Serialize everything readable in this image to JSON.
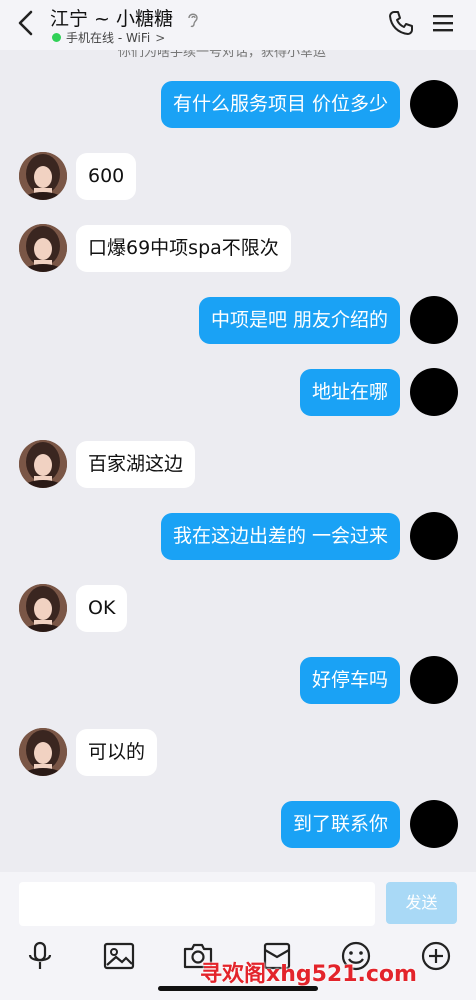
{
  "header": {
    "title": "江宁 ~ 小糖糖",
    "status": "手机在线 - WiFi",
    "status_chevron": ">"
  },
  "partial_top_text": "你们为啥手续一号对话，获得小幸运 ",
  "messages": [
    {
      "from": "me",
      "text": "有什么服务项目 价位多少"
    },
    {
      "from": "her",
      "text": "600"
    },
    {
      "from": "her",
      "text": "口爆69中项spa不限次"
    },
    {
      "from": "me",
      "text": "中项是吧 朋友介绍的"
    },
    {
      "from": "me",
      "text": "地址在哪"
    },
    {
      "from": "her",
      "text": "百家湖这边"
    },
    {
      "from": "me",
      "text": "我在这边出差的 一会过来"
    },
    {
      "from": "her",
      "text": "OK"
    },
    {
      "from": "me",
      "text": "好停车吗"
    },
    {
      "from": "her",
      "text": "可以的"
    },
    {
      "from": "me",
      "text": "到了联系你"
    }
  ],
  "composer": {
    "input_value": "",
    "send_label": "发送"
  },
  "toolbar": {
    "icons": [
      "microphone-icon",
      "image-icon",
      "camera-icon",
      "red-packet-icon",
      "emoji-icon",
      "plus-icon"
    ]
  },
  "watermark": "寻欢阁xhg521.com",
  "colors": {
    "my_bubble": "#1aa2f5",
    "their_bubble": "#ffffff",
    "send_disabled": "#a9d9f6",
    "online": "#31d158"
  }
}
